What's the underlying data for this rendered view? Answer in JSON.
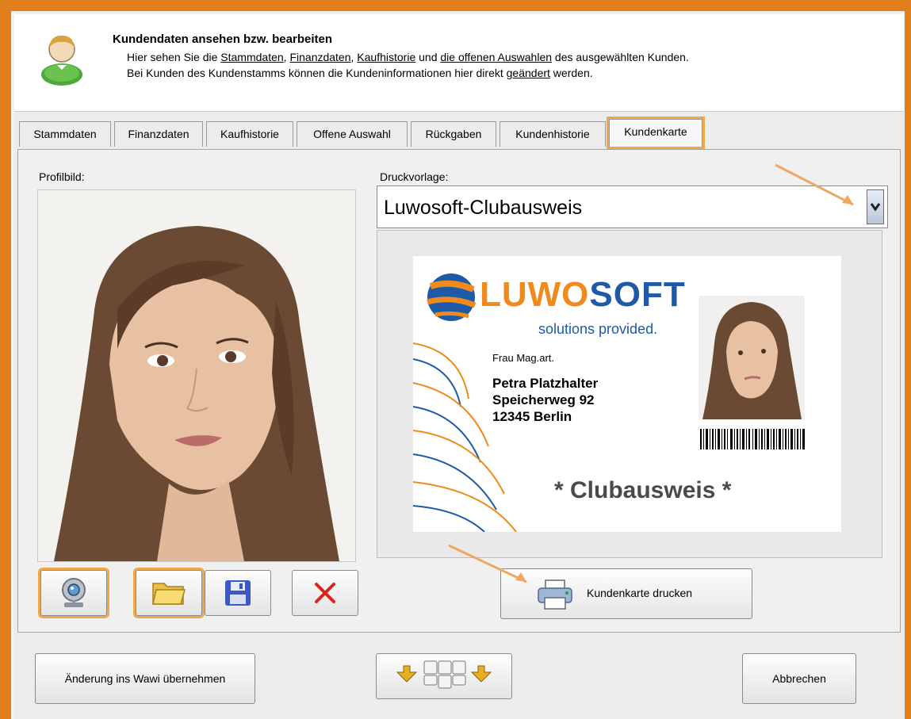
{
  "header": {
    "title": "Kundendaten ansehen bzw. bearbeiten",
    "line1_pre": "Hier sehen Sie die ",
    "link_stammdaten": "Stammdaten",
    "sep1": ", ",
    "link_finanzdaten": "Finanzdaten",
    "sep2": ", ",
    "link_kaufhistorie": "Kaufhistorie",
    "line1_mid": " und ",
    "link_auswahlen": "die offenen Auswahlen",
    "line1_post": " des ausgewählten Kunden.",
    "line2_pre": "Bei Kunden des Kundenstamms können die Kundeninformationen hier direkt ",
    "link_geaendert": "geändert",
    "line2_post": " werden."
  },
  "tabs": [
    {
      "label": "Stammdaten"
    },
    {
      "label": "Finanzdaten"
    },
    {
      "label": "Kaufhistorie"
    },
    {
      "label": "Offene Auswahl"
    },
    {
      "label": "Rückgaben"
    },
    {
      "label": "Kundenhistorie"
    },
    {
      "label": "Kundenkarte",
      "active": true
    }
  ],
  "profile": {
    "label": "Profilbild:"
  },
  "template": {
    "label": "Druckvorlage:",
    "selected": "Luwosoft-Clubausweis"
  },
  "card": {
    "brand_luwo": "LUWO",
    "brand_soft": "SOFT",
    "tagline": "solutions provided.",
    "salutation": "Frau Mag.art.",
    "name": "Petra Platzhalter",
    "street": "Speicherweg 92",
    "city": "12345 Berlin",
    "footer": "* Clubausweis *"
  },
  "buttons": {
    "print_card": "Kundenkarte drucken",
    "apply_wawi": "Änderung ins Wawi übernehmen",
    "cancel": "Abbrechen"
  },
  "colors": {
    "accent_orange": "#e07f1c",
    "highlight": "#efa74a",
    "brand_blue": "#1e5aa8",
    "brand_orange": "#f08a1c"
  }
}
